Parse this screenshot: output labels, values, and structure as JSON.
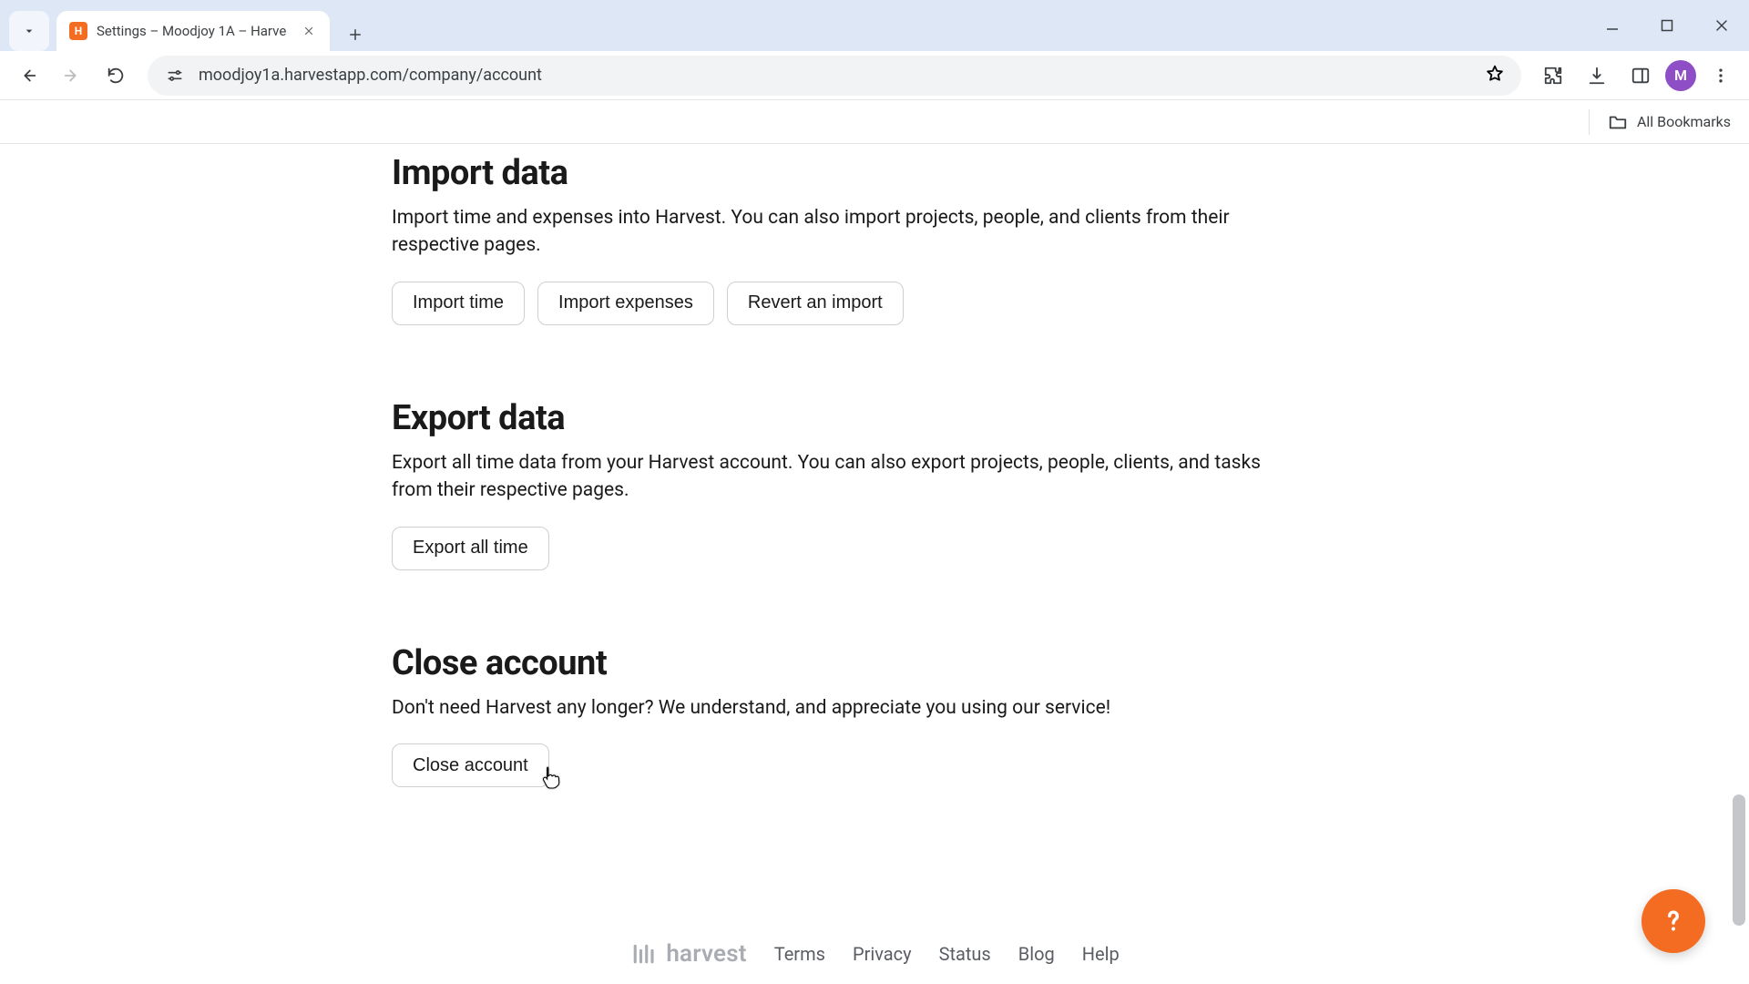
{
  "browser": {
    "tab_title": "Settings – Moodjoy 1A – Harve",
    "address": "moodjoy1a.harvestapp.com/company/account",
    "bookmarks_label": "All Bookmarks",
    "avatar_letter": "M",
    "favicon_letter": "H"
  },
  "sections": {
    "import": {
      "title": "Import data",
      "desc": "Import time and expenses into Harvest. You can also import projects, people, and clients from their respective pages.",
      "buttons": {
        "time": "Import time",
        "expenses": "Import expenses",
        "revert": "Revert an import"
      }
    },
    "export": {
      "title": "Export data",
      "desc": "Export all time data from your Harvest account. You can also export projects, people, clients, and tasks from their respective pages.",
      "buttons": {
        "all_time": "Export all time"
      }
    },
    "close": {
      "title": "Close account",
      "desc": "Don't need Harvest any longer? We understand, and appreciate you using our service!",
      "buttons": {
        "close": "Close account"
      }
    }
  },
  "footer": {
    "brand": "harvest",
    "links": {
      "terms": "Terms",
      "privacy": "Privacy",
      "status": "Status",
      "blog": "Blog",
      "help": "Help"
    }
  }
}
